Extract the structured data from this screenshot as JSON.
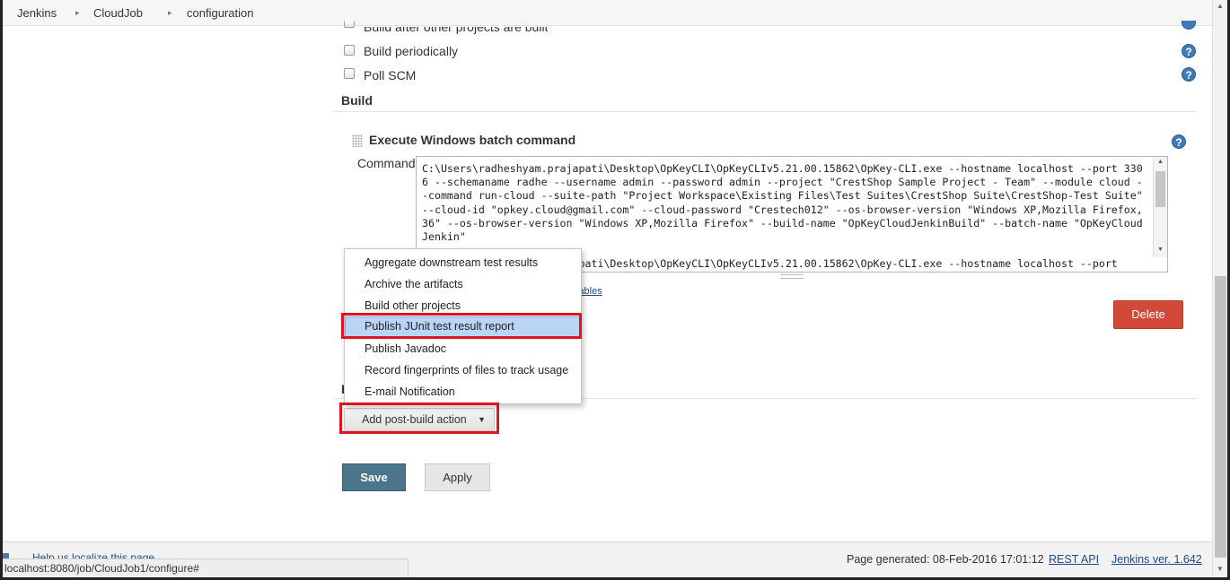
{
  "breadcrumb": {
    "items": [
      "Jenkins",
      "CloudJob",
      "configuration"
    ]
  },
  "triggers": {
    "items": [
      {
        "label": "Build after other projects are built"
      },
      {
        "label": "Build periodically"
      },
      {
        "label": "Poll SCM"
      }
    ]
  },
  "build": {
    "section_title": "Build",
    "step_title": "Execute Windows batch command",
    "command_label": "Command",
    "command_value": "C:\\Users\\radheshyam.prajapati\\Desktop\\OpKeyCLI\\OpKeyCLIv5.21.00.15862\\OpKey-CLI.exe --hostname localhost --port 3306 --schemaname radhe --username admin --password admin --project \"CrestShop Sample Project - Team\" --module cloud --command run-cloud --suite-path \"Project Workspace\\Existing Files\\Test Suites\\CrestShop Suite\\CrestShop-Test Suite\" --cloud-id \"opkey.cloud@gmail.com\" --cloud-password \"Crestech012\" --os-browser-version \"Windows XP,Mozilla Firefox,36\" --os-browser-version \"Windows XP,Mozilla Firefox\" --build-name \"OpKeyCloudJenkinBuild\" --batch-name \"OpKeyCloudJenkin\"\n\nC:\\Users\\radheshyam.prajapati\\Desktop\\OpKeyCLI\\OpKeyCLIv5.21.00.15862\\OpKey-CLI.exe --hostname localhost --port",
    "variables_link_partial": "iables",
    "delete_label": "Delete"
  },
  "post_build_menu": {
    "items": [
      "Aggregate downstream test results",
      "Archive the artifacts",
      "Build other projects",
      "Publish JUnit test result report",
      "Publish Javadoc",
      "Record fingerprints of files to track usage",
      "E-mail Notification"
    ],
    "highlighted": "Publish JUnit test result report"
  },
  "post_build": {
    "section_letter": "P",
    "add_label": "Add post-build action",
    "caret": "▾"
  },
  "actions": {
    "save_label": "Save",
    "apply_label": "Apply"
  },
  "footer": {
    "localize_label": "Help us localize this page",
    "page_generated": "Page generated: 08-Feb-2016 17:01:12",
    "rest_api": "REST API",
    "jenkins_version": "Jenkins ver. 1.642"
  },
  "status_bar": {
    "url": "localhost:8080/job/CloudJob1/configure#"
  },
  "icons": {
    "help": "?",
    "breadcrumb_separator": "▸"
  },
  "colors": {
    "delete": "#d24939",
    "save": "#4b758b",
    "highlight_border": "#e0141e",
    "menu_highlight": "#b9d4f5",
    "link": "#204a87"
  }
}
